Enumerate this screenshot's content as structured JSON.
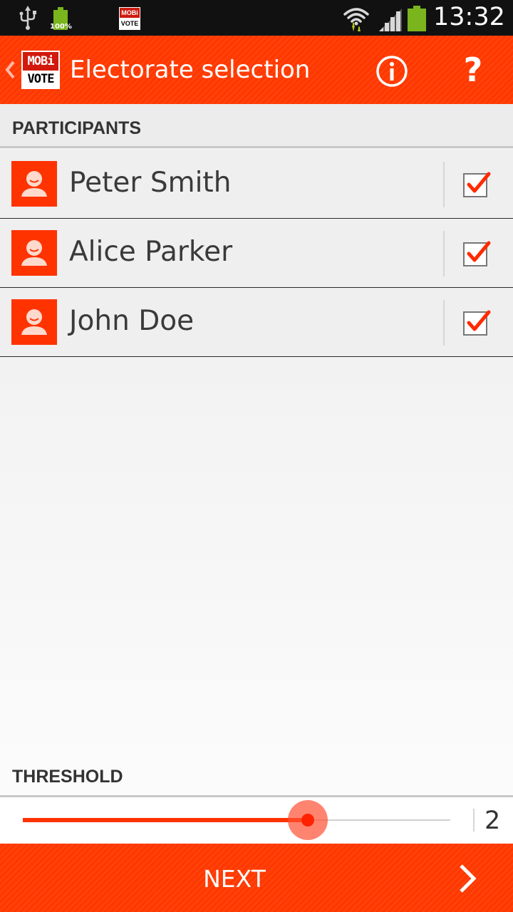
{
  "status_bar": {
    "time": "13:32",
    "battery_small_label": "100%",
    "app_logo_top": "MOBi",
    "app_logo_bottom": "VOTE",
    "icons": [
      "usb-icon",
      "battery-icon",
      "app-notification-icon",
      "wifi-icon",
      "signal-icon",
      "battery-icon"
    ]
  },
  "action_bar": {
    "logo_top": "MOBi",
    "logo_bottom": "VOTE",
    "title": "Electorate selection",
    "icons": [
      "back-chevron-icon",
      "info-icon",
      "help-icon"
    ],
    "help_glyph": "?"
  },
  "participants": {
    "header": "PARTICIPANTS",
    "items": [
      {
        "name": "Peter Smith",
        "checked": true
      },
      {
        "name": "Alice Parker",
        "checked": true
      },
      {
        "name": "John Doe",
        "checked": true
      }
    ]
  },
  "threshold": {
    "header": "THRESHOLD",
    "value": "2",
    "min": 0,
    "max": 3,
    "fraction": 0.667
  },
  "footer": {
    "next_label": "NEXT"
  },
  "colors": {
    "accent": "#ff3800",
    "avatar_bg": "#ff3300",
    "check": "#ff2a00",
    "status_bar_bg": "#111111",
    "battery": "#7ab51d"
  }
}
